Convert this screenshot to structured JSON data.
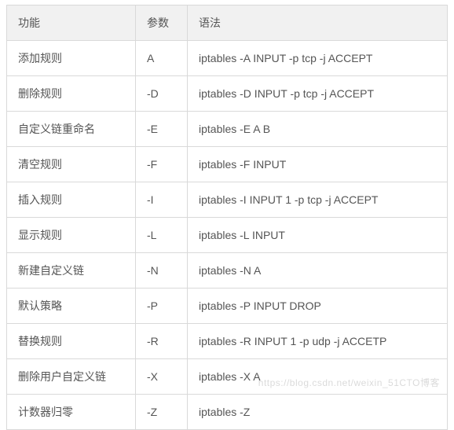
{
  "headers": {
    "col1": "功能",
    "col2": "参数",
    "col3": "语法"
  },
  "rows": [
    {
      "func": "添加规则",
      "param": "A",
      "syntax": "iptables -A INPUT -p tcp -j ACCEPT"
    },
    {
      "func": "删除规则",
      "param": "-D",
      "syntax": "iptables -D INPUT -p tcp -j ACCEPT"
    },
    {
      "func": "自定义链重命名",
      "param": "-E",
      "syntax": "iptables -E A B"
    },
    {
      "func": "清空规则",
      "param": "-F",
      "syntax": "iptables -F INPUT"
    },
    {
      "func": "插入规则",
      "param": "-I",
      "syntax": "iptables -I INPUT 1 -p tcp -j ACCEPT"
    },
    {
      "func": "显示规则",
      "param": "-L",
      "syntax": "iptables -L INPUT"
    },
    {
      "func": "新建自定义链",
      "param": "-N",
      "syntax": "iptables -N A"
    },
    {
      "func": "默认策略",
      "param": "-P",
      "syntax": "iptables -P INPUT DROP"
    },
    {
      "func": "替换规则",
      "param": "-R",
      "syntax": "iptables -R INPUT 1 -p udp -j ACCETP"
    },
    {
      "func": "删除用户自定义链",
      "param": "-X",
      "syntax": "iptables -X A"
    },
    {
      "func": "计数器归零",
      "param": "-Z",
      "syntax": "iptables -Z"
    }
  ],
  "watermark": "https://blog.csdn.net/weixin_51CTO博客"
}
